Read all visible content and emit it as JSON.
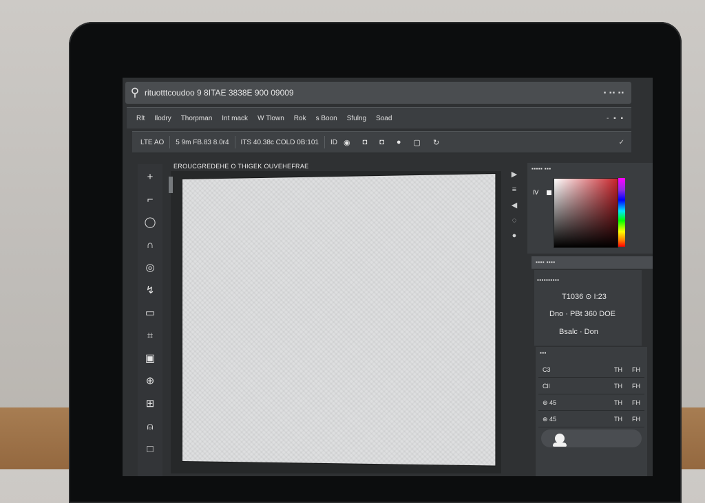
{
  "search": {
    "query": "rituotttcoudoo 9 8ITAE 3838E 900 09009",
    "window_controls": "▪ ▪▪ ▪▪"
  },
  "menubar": {
    "items": [
      "Rlt",
      "Ilodry",
      "Thorpman",
      "Int mack",
      "W Tlown",
      "Rok",
      "s Boon",
      "Sfulng",
      "Soad"
    ],
    "controls": "- ▪ ▪"
  },
  "options": {
    "label": "LTE AO",
    "value": "5 9m FB.83 8.0r4",
    "value2": "ITS 40.38c COLD 0B:101",
    "mode": "ID",
    "icons": [
      "circle-icon",
      "square-icon",
      "square-icon",
      "circle-icon",
      "square-icon",
      "rotate-icon"
    ],
    "end": "✓"
  },
  "tools": [
    "move-icon",
    "brush-icon",
    "lasso-icon",
    "pen-icon",
    "circle-icon",
    "eyedropper-icon",
    "rectangle-icon",
    "crop-icon",
    "frame-icon",
    "globe-icon",
    "grid-icon",
    "lock-icon",
    "square-icon"
  ],
  "document": {
    "tab_title": "EROUCGREDEHE O THIGEK OUVEHEFRAE"
  },
  "color_panel": {
    "title": "▪▪▪▪▪ ▪▪▪",
    "swatch_label": "Ⅳ"
  },
  "properties": {
    "tab": "▪▪▪▪ ▪▪▪▪",
    "title": "▪▪▪▪▪▪▪▪▪▪",
    "rows": [
      "T1036 ⊙ I:23",
      "Dno · PBt 360 DOE",
      "Bsalc · Don"
    ]
  },
  "layers": {
    "title": "▪▪▪",
    "rows": [
      {
        "left": "C3",
        "mid": "TH",
        "right": "FH"
      },
      {
        "left": "Cll",
        "mid": "TH",
        "right": "FH"
      },
      {
        "left": "⊕ 45",
        "mid": "TH",
        "right": "FH"
      },
      {
        "left": "⊕ 45",
        "mid": "TH",
        "right": "FH"
      }
    ]
  }
}
